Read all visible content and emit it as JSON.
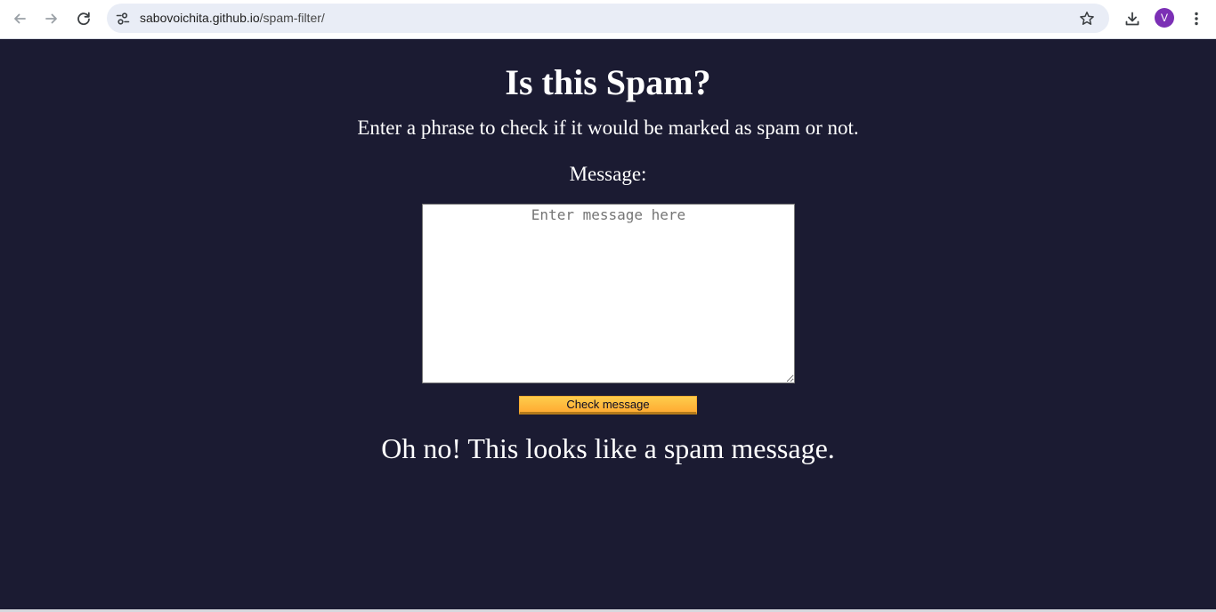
{
  "browser": {
    "url_host": "sabovoichita.github.io",
    "url_path": "/spam-filter/",
    "profile_initial": "V",
    "profile_color": "#7b2fb5",
    "icons": [
      "back-arrow-icon",
      "forward-arrow-icon",
      "reload-icon",
      "site-info-icon",
      "bookmark-star-icon",
      "download-icon",
      "kebab-menu-icon"
    ]
  },
  "page": {
    "title": "Is this Spam?",
    "subtitle": "Enter a phrase to check if it would be marked as spam or not.",
    "message_label": "Message:",
    "message_value": "",
    "message_placeholder": "Enter message here",
    "check_button_label": "Check message",
    "result_text": "Oh no! This looks like a spam message.",
    "background_color": "#1b1b32",
    "button_color": "#feac32"
  }
}
